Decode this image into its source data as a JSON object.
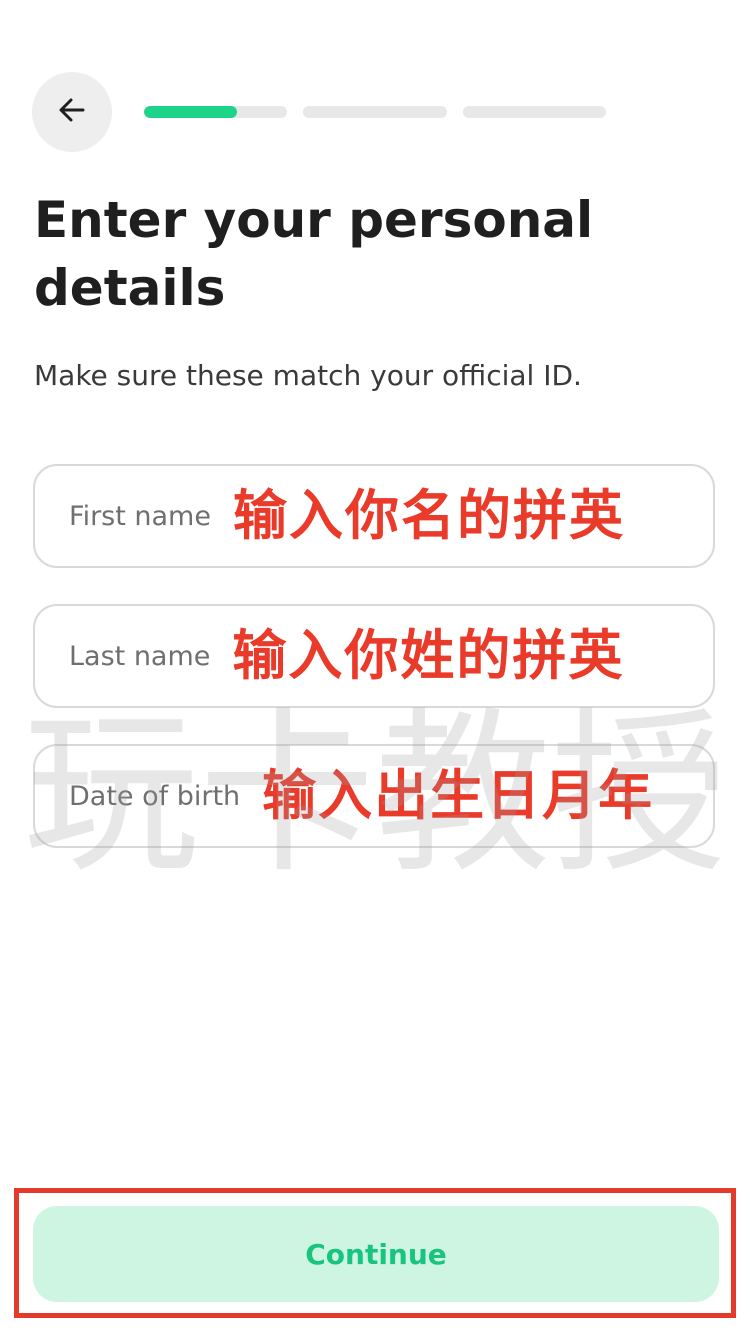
{
  "header": {
    "back_icon": "arrow-left-icon",
    "progress": {
      "steps_total": 3,
      "step_fills": [
        0.65,
        0,
        0
      ],
      "active_color": "#1ed38a",
      "inactive_color": "#e8e8e8"
    }
  },
  "main": {
    "title": "Enter your personal details",
    "subtitle": "Make sure these match your official ID.",
    "fields": [
      {
        "placeholder": "First name",
        "annotation": "输入你名的拼英"
      },
      {
        "placeholder": "Last name",
        "annotation": "输入你姓的拼英"
      },
      {
        "placeholder": "Date of birth",
        "annotation": "输入出生日月年"
      }
    ]
  },
  "watermark": "玩卡教授",
  "footer": {
    "continue_label": "Continue",
    "continue_text_color": "#19c47e",
    "continue_bg_color": "#cdf5e2",
    "highlight_color": "#e33a2b"
  }
}
